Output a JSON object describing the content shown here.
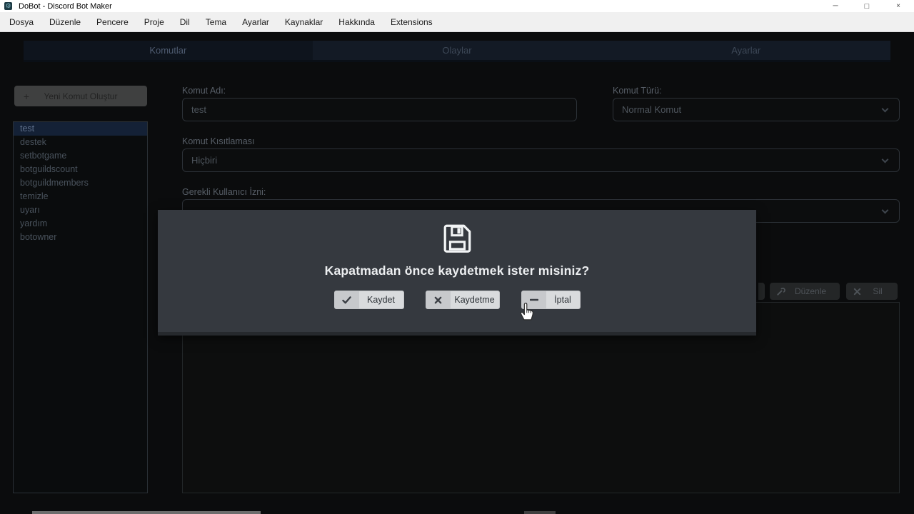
{
  "window": {
    "title": "DoBot - Discord Bot Maker",
    "controls": {
      "minimize": "─",
      "maximize": "□",
      "close": "×"
    }
  },
  "menu": {
    "items": [
      "Dosya",
      "Düzenle",
      "Pencere",
      "Proje",
      "Dil",
      "Tema",
      "Ayarlar",
      "Kaynaklar",
      "Hakkında",
      "Extensions"
    ]
  },
  "tabs": [
    {
      "label": "Komutlar",
      "active": true
    },
    {
      "label": "Olaylar",
      "active": false
    },
    {
      "label": "Ayarlar",
      "active": false
    }
  ],
  "sidebar": {
    "plus": "+",
    "new_command_button": "Yeni Komut Oluştur",
    "commands": [
      "test",
      "destek",
      "setbotgame",
      "botguildscount",
      "botguildmembers",
      "temizle",
      "uyarı",
      "yardım",
      "botowner"
    ],
    "selected_command": "test"
  },
  "form": {
    "name_label": "Komut Adı:",
    "name_value": "test",
    "type_label": "Komut Türü:",
    "type_value": "Normal Komut",
    "restriction_label": "Komut Kısıtlaması",
    "restriction_value": "Hiçbiri",
    "permission_label": "Gerekli Kullanıcı İzni:",
    "permission_value": ""
  },
  "actions": {
    "edit_label": "Düzenle",
    "delete_label": "Sil"
  },
  "dialog": {
    "message": "Kapatmadan önce kaydetmek ister misiniz?",
    "buttons": [
      {
        "label": "Kaydet",
        "icon": "check-icon"
      },
      {
        "label": "Kaydetme",
        "icon": "x-icon"
      },
      {
        "label": "İptal",
        "icon": "minus-icon"
      }
    ]
  },
  "colors": {
    "selection_highlight": "#142136",
    "modal_background": "#35393f",
    "modal_button": "#d9dbdd",
    "titlebar": "#ffffff",
    "menubar": "#f0f0f0"
  }
}
